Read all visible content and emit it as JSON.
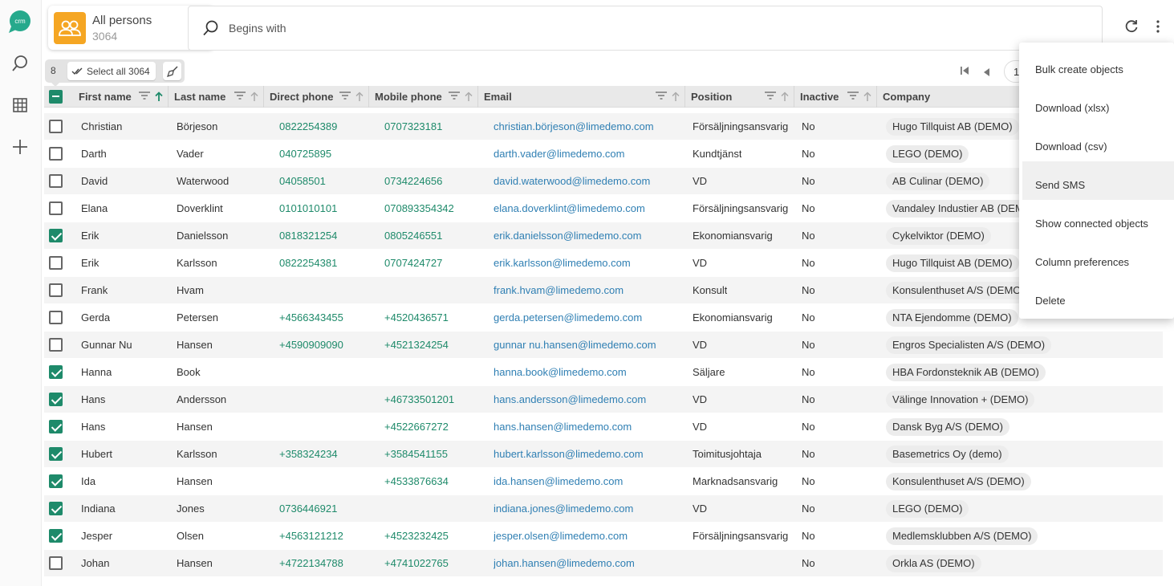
{
  "nav": {
    "logo_text": "crm",
    "items": [
      {
        "icon": "search-icon"
      },
      {
        "icon": "grid-icon"
      },
      {
        "icon": "plus-icon"
      }
    ]
  },
  "limetype": {
    "title": "All persons",
    "count": "3064",
    "icon": "people-icon",
    "color": "#f5a623"
  },
  "search": {
    "placeholder": "Begins with",
    "value": ""
  },
  "selection": {
    "count": "8",
    "select_all_label": "Select all 3064"
  },
  "pager": {
    "page": "1"
  },
  "columns": [
    {
      "label": "First name",
      "sorted": true
    },
    {
      "label": "Last name"
    },
    {
      "label": "Direct phone"
    },
    {
      "label": "Mobile phone"
    },
    {
      "label": "Email"
    },
    {
      "label": "Position"
    },
    {
      "label": "Inactive"
    },
    {
      "label": "Company"
    }
  ],
  "rows": [
    {
      "checked": false,
      "first": "",
      "last": "",
      "direct": "",
      "mobile": "",
      "email": "",
      "position": "",
      "inactive": "",
      "company": ""
    },
    {
      "checked": false,
      "first": "Christian",
      "last": "Börjeson",
      "direct": "0822254389",
      "mobile": "0707323181",
      "email": "christian.börjeson@limedemo.com",
      "position": "Försäljningsansvarig",
      "inactive": "No",
      "company": "Hugo Tillquist AB (DEMO)"
    },
    {
      "checked": false,
      "first": "Darth",
      "last": "Vader",
      "direct": "040725895",
      "mobile": "",
      "email": "darth.vader@limedemo.com",
      "position": "Kundtjänst",
      "inactive": "No",
      "company": "LEGO (DEMO)"
    },
    {
      "checked": false,
      "first": "David",
      "last": "Waterwood",
      "direct": "04058501",
      "mobile": "0734224656",
      "email": "david.waterwood@limedemo.com",
      "position": "VD",
      "inactive": "No",
      "company": "AB Culinar (DEMO)"
    },
    {
      "checked": false,
      "first": "Elana",
      "last": "Doverklint",
      "direct": "0101010101",
      "mobile": "070893354342",
      "email": "elana.doverklint@limedemo.com",
      "position": "Försäljningsansvarig",
      "inactive": "No",
      "company": "Vandaley Industier AB (DEMO)"
    },
    {
      "checked": true,
      "first": "Erik",
      "last": "Danielsson",
      "direct": "0818321254",
      "mobile": "0805246551",
      "email": "erik.danielsson@limedemo.com",
      "position": "Ekonomiansvarig",
      "inactive": "No",
      "company": "Cykelviktor (DEMO)"
    },
    {
      "checked": false,
      "first": "Erik",
      "last": "Karlsson",
      "direct": "0822254381",
      "mobile": "0707424727",
      "email": "erik.karlsson@limedemo.com",
      "position": "VD",
      "inactive": "No",
      "company": "Hugo Tillquist AB (DEMO)"
    },
    {
      "checked": false,
      "first": "Frank",
      "last": "Hvam",
      "direct": "",
      "mobile": "",
      "email": "frank.hvam@limedemo.com",
      "position": "Konsult",
      "inactive": "No",
      "company": "Konsulenthuset A/S (DEMO)"
    },
    {
      "checked": false,
      "first": "Gerda",
      "last": "Petersen",
      "direct": "+4566343455",
      "mobile": "+4520436571",
      "email": "gerda.petersen@limedemo.com",
      "position": "Ekonomiansvarig",
      "inactive": "No",
      "company": "NTA Ejendomme (DEMO)"
    },
    {
      "checked": false,
      "first": "Gunnar Nu",
      "last": "Hansen",
      "direct": "+4590909090",
      "mobile": "+4521324254",
      "email": "gunnar nu.hansen@limedemo.com",
      "position": "VD",
      "inactive": "No",
      "company": "Engros Specialisten A/S (DEMO)"
    },
    {
      "checked": true,
      "first": "Hanna",
      "last": "Book",
      "direct": "",
      "mobile": "",
      "email": "hanna.book@limedemo.com",
      "position": "Säljare",
      "inactive": "No",
      "company": "HBA Fordonsteknik AB (DEMO)"
    },
    {
      "checked": true,
      "first": "Hans",
      "last": "Andersson",
      "direct": "",
      "mobile": "+46733501201",
      "email": "hans.andersson@limedemo.com",
      "position": "VD",
      "inactive": "No",
      "company": "Välinge Innovation + (DEMO)"
    },
    {
      "checked": true,
      "first": "Hans",
      "last": "Hansen",
      "direct": "",
      "mobile": "+4522667272",
      "email": "hans.hansen@limedemo.com",
      "position": "VD",
      "inactive": "No",
      "company": "Dansk Byg A/S (DEMO)"
    },
    {
      "checked": true,
      "first": "Hubert",
      "last": "Karlsson",
      "direct": "+358324234",
      "mobile": "+3584541155",
      "email": "hubert.karlsson@limedemo.com",
      "position": "Toimitusjohtaja",
      "inactive": "No",
      "company": "Basemetrics Oy (demo)"
    },
    {
      "checked": true,
      "first": "Ida",
      "last": "Hansen",
      "direct": "",
      "mobile": "+4533876634",
      "email": "ida.hansen@limedemo.com",
      "position": "Marknadsansvarig",
      "inactive": "No",
      "company": "Konsulenthuset A/S (DEMO)"
    },
    {
      "checked": true,
      "first": "Indiana",
      "last": "Jones",
      "direct": "0736446921",
      "mobile": "",
      "email": "indiana.jones@limedemo.com",
      "position": "VD",
      "inactive": "No",
      "company": "LEGO (DEMO)"
    },
    {
      "checked": true,
      "first": "Jesper",
      "last": "Olsen",
      "direct": "+4563121212",
      "mobile": "+4523232425",
      "email": "jesper.olsen@limedemo.com",
      "position": "Försäljningsansvarig",
      "inactive": "No",
      "company": "Medlemsklubben A/S (DEMO)"
    },
    {
      "checked": false,
      "first": "Johan",
      "last": "Hansen",
      "direct": "+4722134788",
      "mobile": "+4741022765",
      "email": "johan.hansen@limedemo.com",
      "position": "",
      "inactive": "No",
      "company": "Orkla AS (DEMO)"
    }
  ],
  "menu": {
    "items": [
      {
        "label": "Bulk create objects"
      },
      {
        "label": "Download (xlsx)"
      },
      {
        "label": "Download (csv)"
      },
      {
        "label": "Send SMS",
        "active": true
      },
      {
        "label": "Show connected objects"
      },
      {
        "label": "Column preferences"
      },
      {
        "label": "Delete"
      }
    ]
  },
  "colors": {
    "accent": "#1e8a6a",
    "link": "#2f7fb3",
    "limetype": "#f5a623",
    "logo": "#26a98c"
  }
}
